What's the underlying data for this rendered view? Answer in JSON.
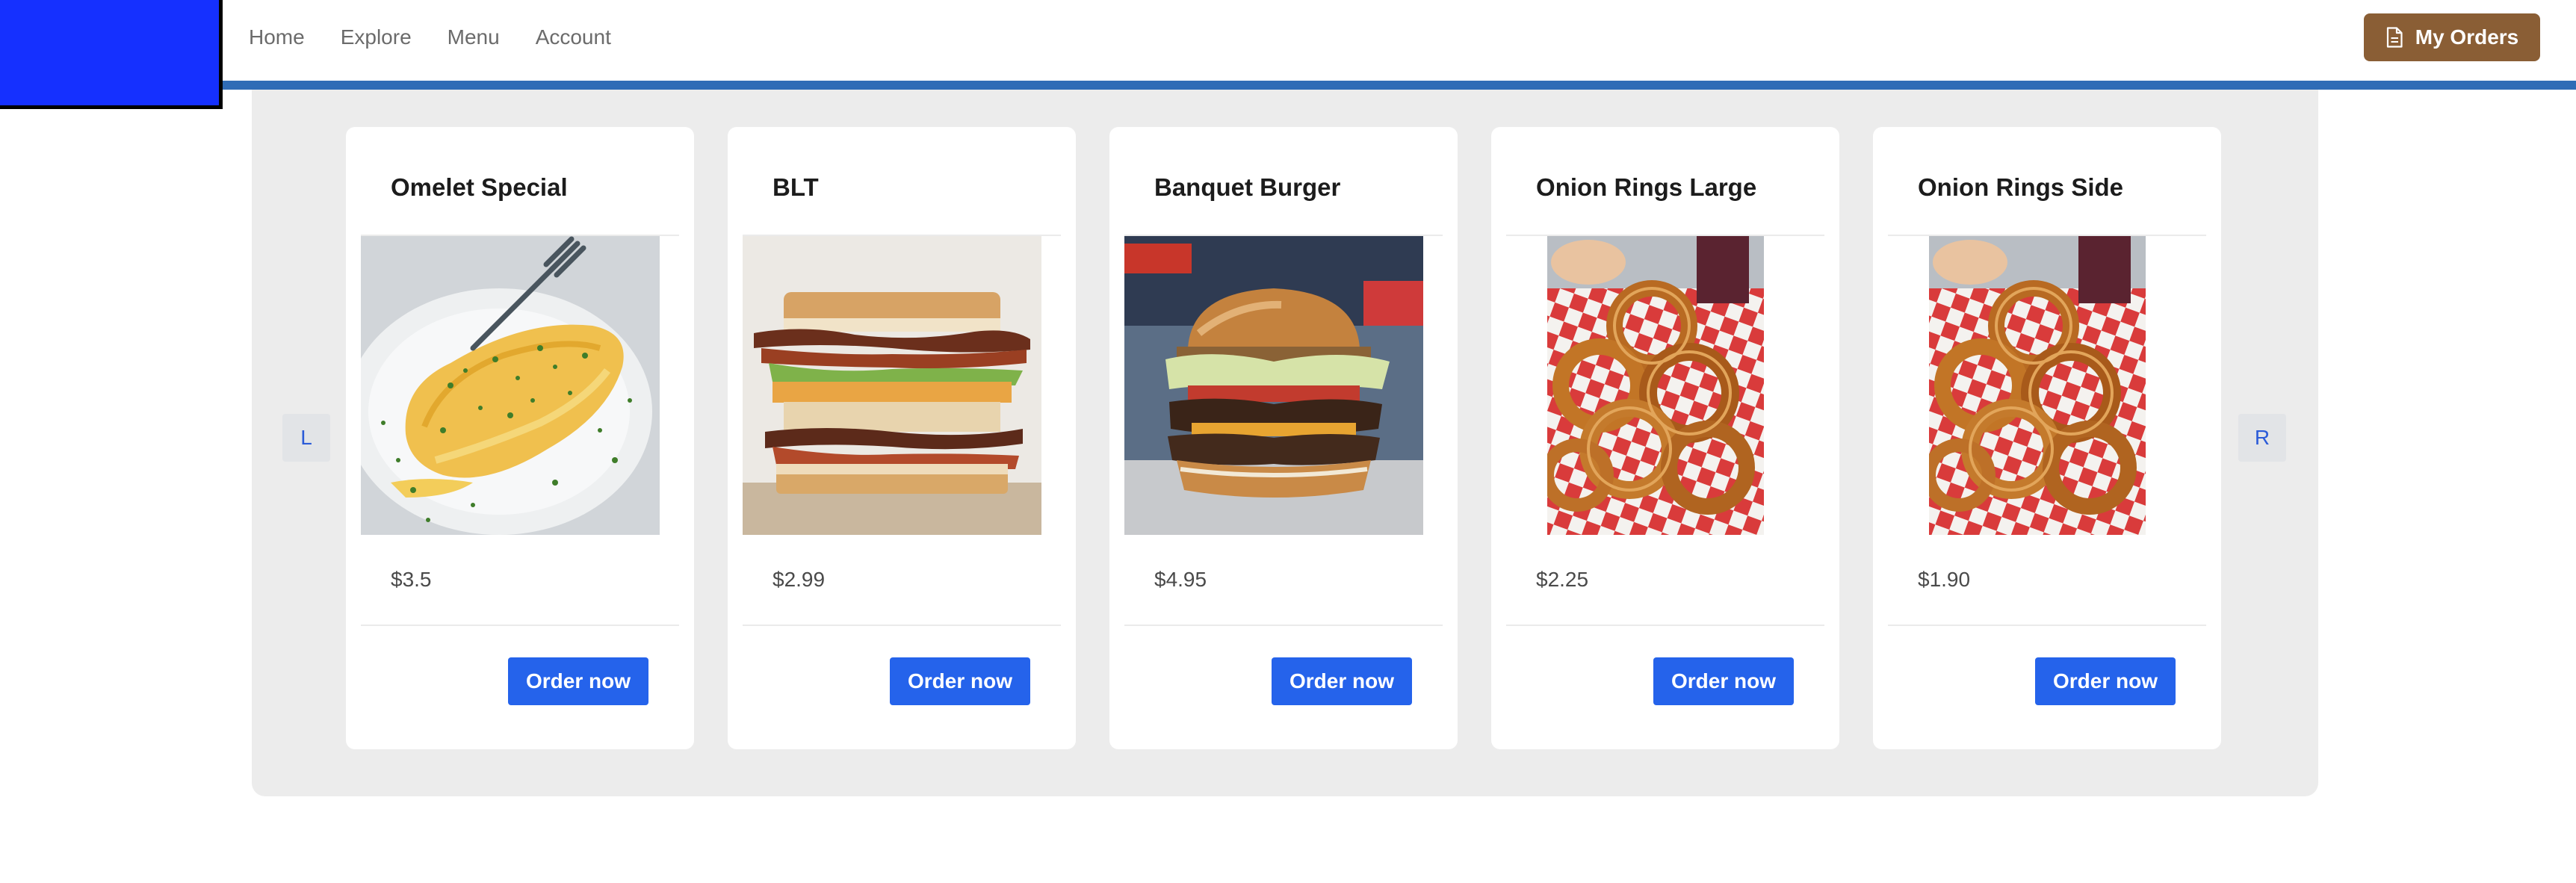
{
  "nav": {
    "links": [
      "Home",
      "Explore",
      "Menu",
      "Account"
    ],
    "orders_label": "My Orders",
    "orders_icon": "document-icon"
  },
  "carousel": {
    "left_label": "L",
    "right_label": "R",
    "items": [
      {
        "title": "Omelet Special",
        "price": "$3.5",
        "button": "Order now",
        "image": "omelet-photo"
      },
      {
        "title": "BLT",
        "price": "$2.99",
        "button": "Order now",
        "image": "blt-sandwich-photo"
      },
      {
        "title": "Banquet Burger",
        "price": "$4.95",
        "button": "Order now",
        "image": "burger-photo"
      },
      {
        "title": "Onion Rings Large",
        "price": "$2.25",
        "button": "Order now",
        "image": "onion-rings-photo"
      },
      {
        "title": "Onion Rings Side",
        "price": "$1.90",
        "button": "Order now",
        "image": "onion-rings-photo"
      }
    ]
  },
  "colors": {
    "logo": "#1530ff",
    "nav_border": "#2f6cb6",
    "orders_button": "#8a5e35",
    "order_button": "#2563eb",
    "panel": "#ececec"
  }
}
